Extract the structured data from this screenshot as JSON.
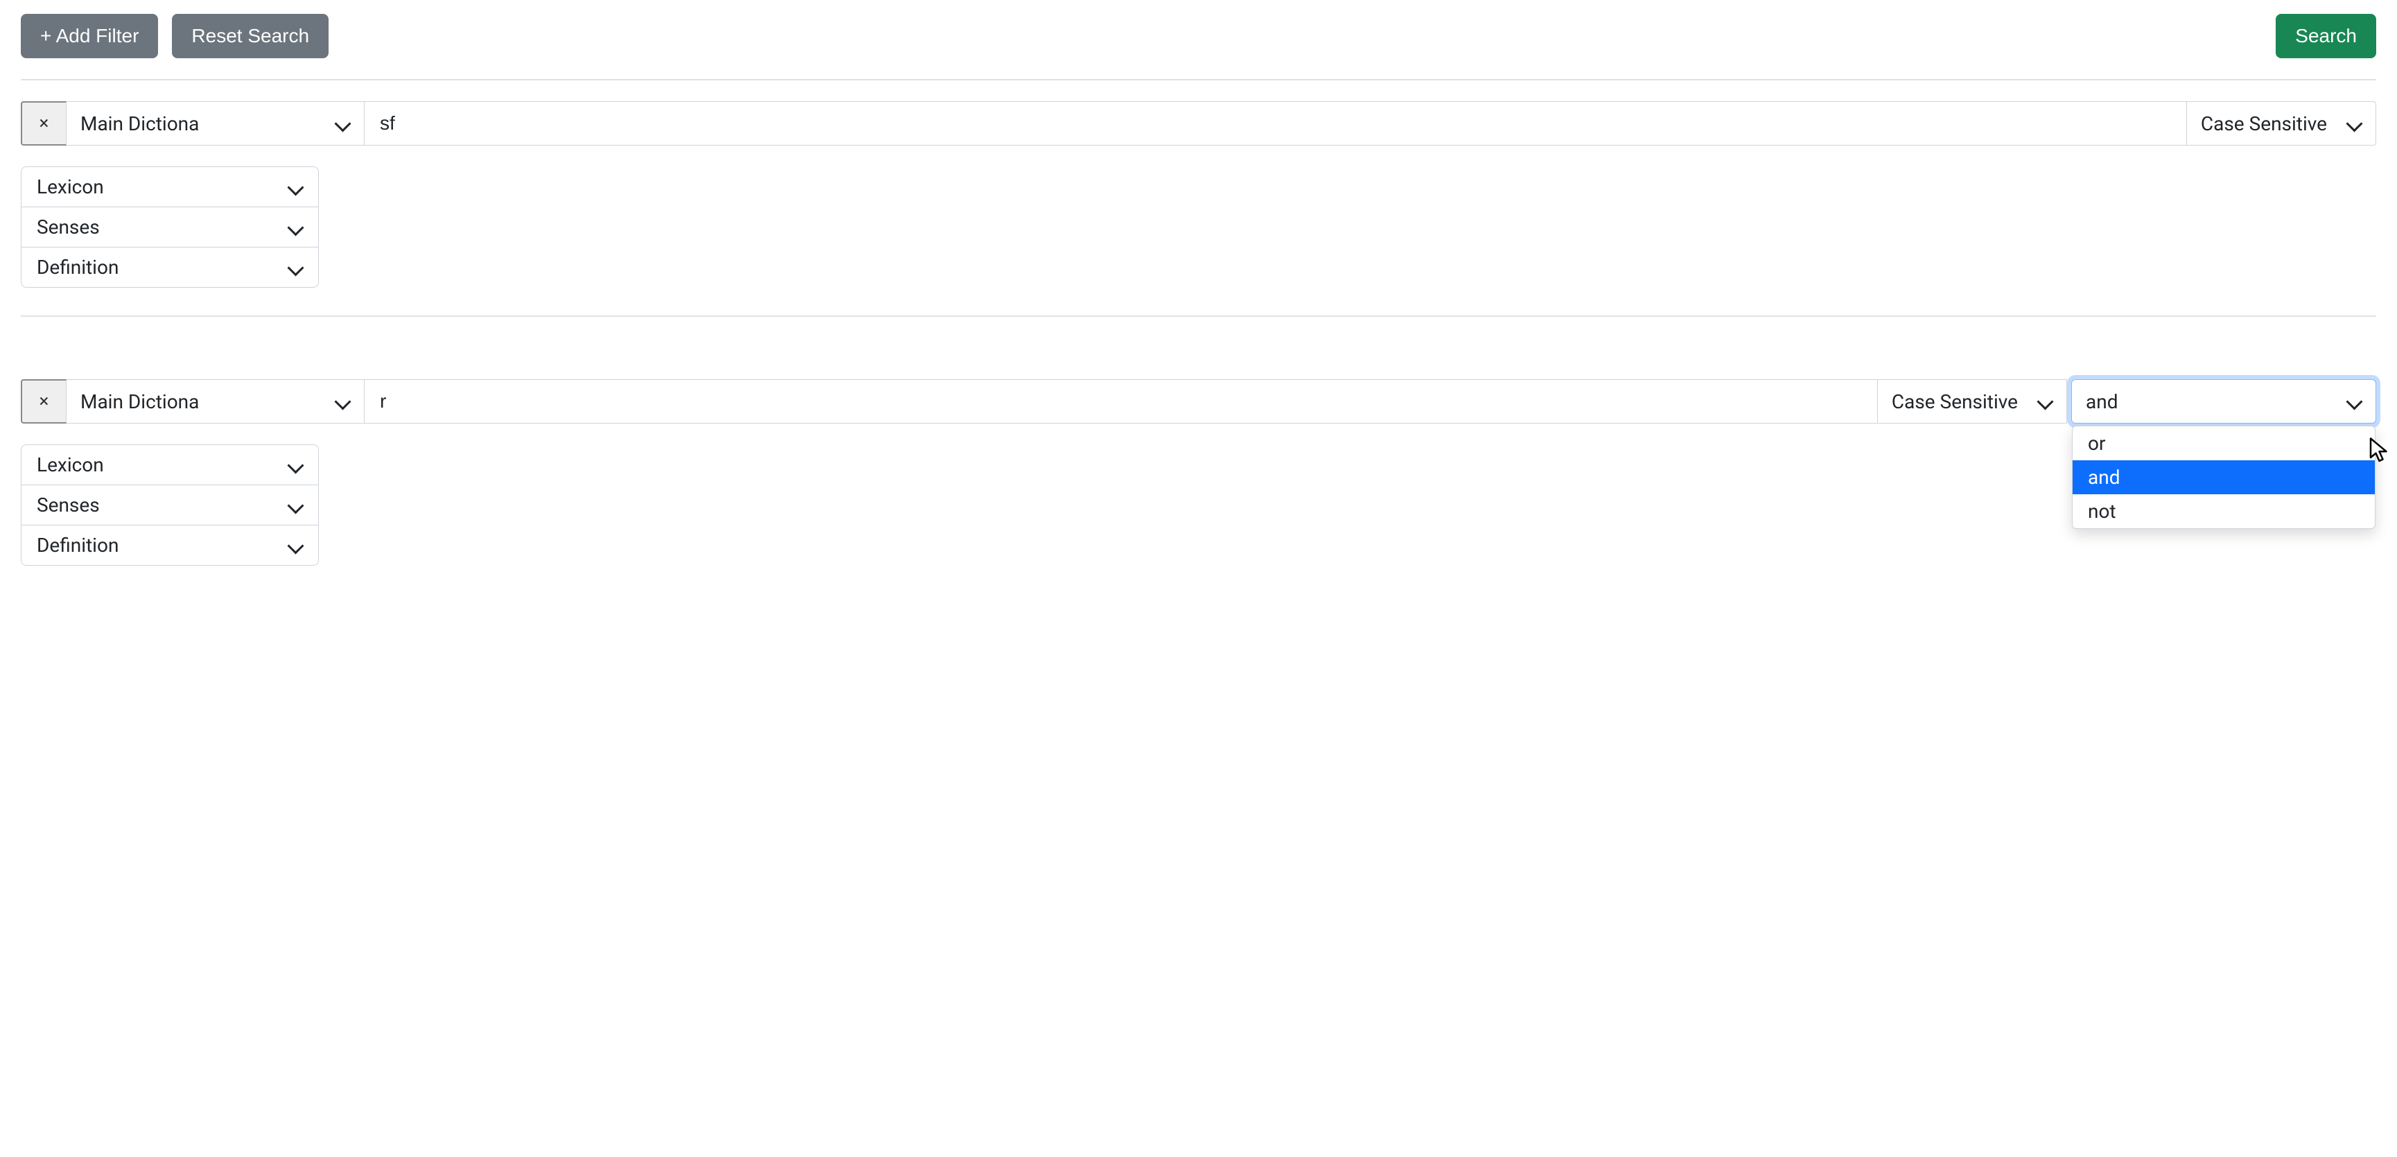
{
  "toolbar": {
    "add_filter_label": "+ Add Filter",
    "reset_label": "Reset Search",
    "search_label": "Search"
  },
  "filters": [
    {
      "field_label": "Main Dictiona",
      "query": "sf",
      "case_label": "Case Sensitive",
      "operator_open": false,
      "operator_value": "",
      "attrs": [
        "Lexicon",
        "Senses",
        "Definition"
      ]
    },
    {
      "field_label": "Main Dictiona",
      "query": "r",
      "case_label": "Case Sensitive",
      "operator_open": true,
      "operator_value": "and",
      "operator_options": [
        "or",
        "and",
        "not"
      ],
      "attrs": [
        "Lexicon",
        "Senses",
        "Definition"
      ]
    }
  ]
}
